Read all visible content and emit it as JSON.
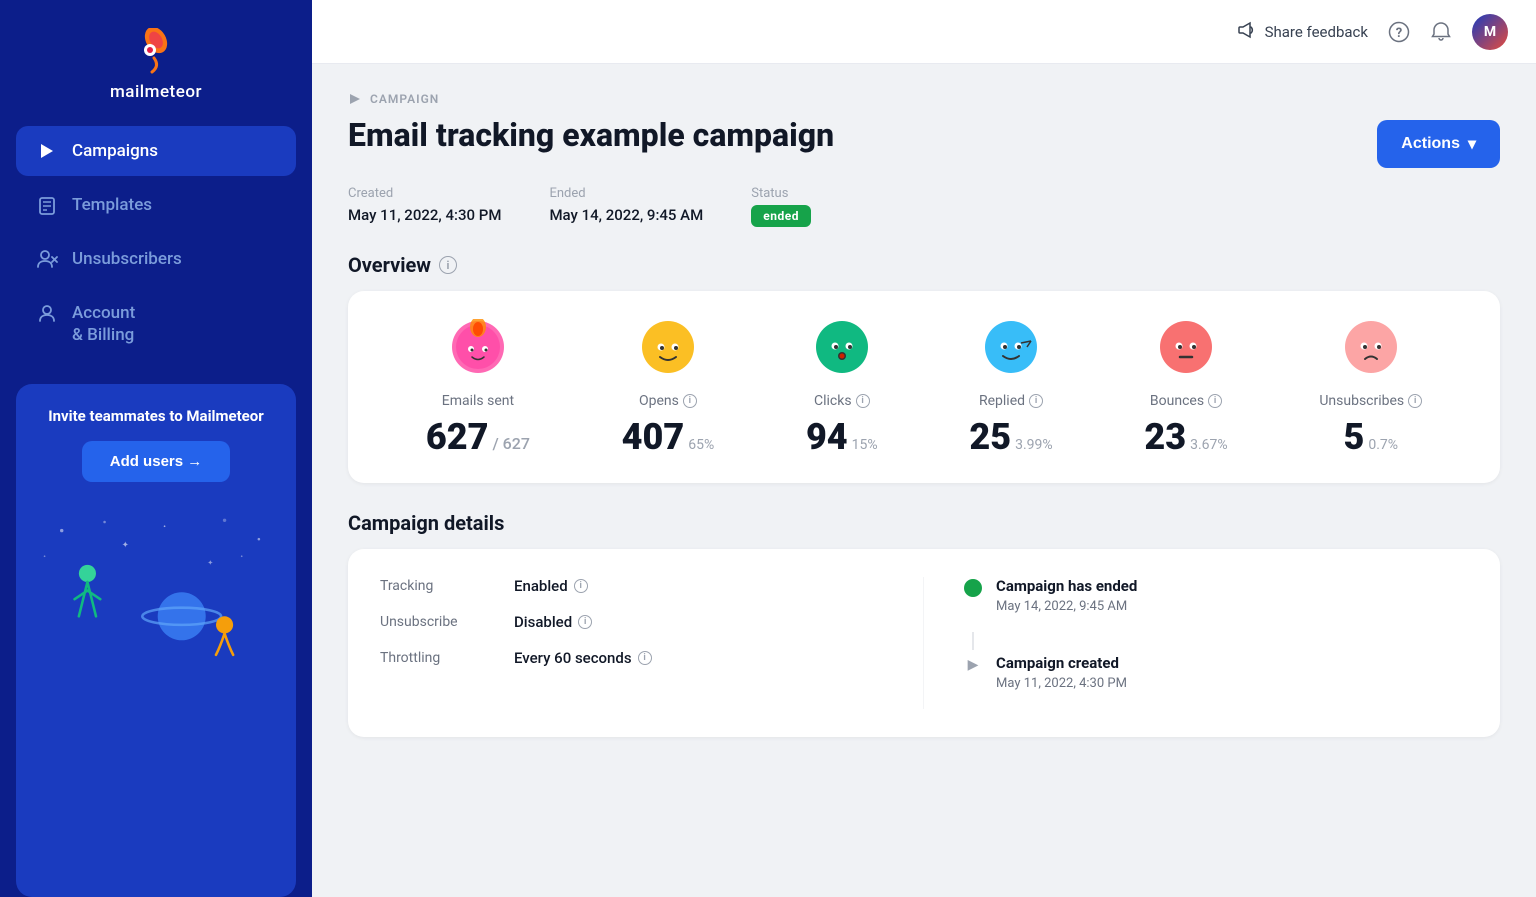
{
  "sidebar": {
    "brand": "mailmeteor",
    "nav_items": [
      {
        "id": "campaigns",
        "label": "Campaigns",
        "active": true
      },
      {
        "id": "templates",
        "label": "Templates",
        "active": false
      },
      {
        "id": "unsubscribers",
        "label": "Unsubscribers",
        "active": false
      },
      {
        "id": "account-billing",
        "label": "Account\n& Billing",
        "active": false
      }
    ],
    "invite_title": "Invite teammates to Mailmeteor",
    "add_users_label": "Add users →"
  },
  "topbar": {
    "share_feedback": "Share feedback",
    "help_icon": "?",
    "bell_icon": "🔔"
  },
  "page": {
    "breadcrumb": "CAMPAIGN",
    "title": "Email tracking example campaign",
    "actions_label": "Actions",
    "created_label": "Created",
    "created_value": "May 11, 2022, 4:30 PM",
    "ended_label": "Ended",
    "ended_value": "May 14, 2022, 9:45 AM",
    "status_label": "Status",
    "status_value": "ended"
  },
  "overview": {
    "title": "Overview",
    "stats": [
      {
        "id": "emails-sent",
        "emoji": "😊",
        "emoji_color": "pink",
        "label": "Emails sent",
        "main": "627",
        "secondary": "/ 627",
        "pct": ""
      },
      {
        "id": "opens",
        "emoji": "😊",
        "emoji_color": "yellow",
        "label": "Opens",
        "main": "407",
        "secondary": "",
        "pct": "65%"
      },
      {
        "id": "clicks",
        "emoji": "😮",
        "emoji_color": "teal",
        "label": "Clicks",
        "main": "94",
        "secondary": "",
        "pct": "15%"
      },
      {
        "id": "replied",
        "emoji": "😄",
        "emoji_color": "blue",
        "label": "Replied",
        "main": "25",
        "secondary": "",
        "pct": "3.99%"
      },
      {
        "id": "bounces",
        "emoji": "😐",
        "emoji_color": "red-orange",
        "label": "Bounces",
        "main": "23",
        "secondary": "",
        "pct": "3.67%"
      },
      {
        "id": "unsubscribes",
        "emoji": "😟",
        "emoji_color": "pink-light",
        "label": "Unsubscribes",
        "main": "5",
        "secondary": "",
        "pct": "0.7%"
      }
    ]
  },
  "campaign_details": {
    "title": "Campaign details",
    "rows": [
      {
        "key": "Tracking",
        "value": "Enabled"
      },
      {
        "key": "Unsubscribe",
        "value": "Disabled"
      },
      {
        "key": "Throttling",
        "value": "Every 60 seconds"
      }
    ],
    "timeline": [
      {
        "type": "dot",
        "label": "Campaign has ended",
        "date": "May 14, 2022, 9:45 AM"
      },
      {
        "type": "arrow",
        "label": "Campaign created",
        "date": "May 11, 2022, 4:30 PM"
      }
    ]
  }
}
